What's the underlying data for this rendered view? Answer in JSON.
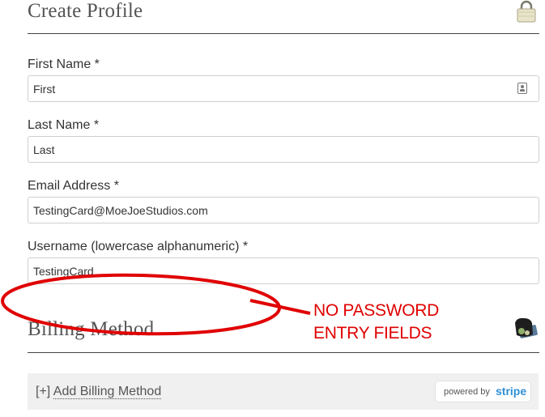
{
  "profile": {
    "title": "Create Profile",
    "icon": "padlock-icon"
  },
  "form": {
    "first_name": {
      "label": "First Name *",
      "value": "First"
    },
    "last_name": {
      "label": "Last Name *",
      "value": "Last"
    },
    "email": {
      "label": "Email Address *",
      "value": "TestingCard@MoeJoeStudios.com"
    },
    "username": {
      "label": "Username (lowercase alphanumeric) *",
      "value": "TestingCard"
    }
  },
  "billing": {
    "title": "Billing Method",
    "icon": "wallet-icon",
    "add_prefix": "[+]",
    "add_label": "Add Billing Method",
    "powered_by": "powered by",
    "brand": "stripe"
  },
  "annotation": {
    "line1": "NO PASSWORD",
    "line2": "ENTRY FIELDS",
    "color": "#e00000"
  }
}
